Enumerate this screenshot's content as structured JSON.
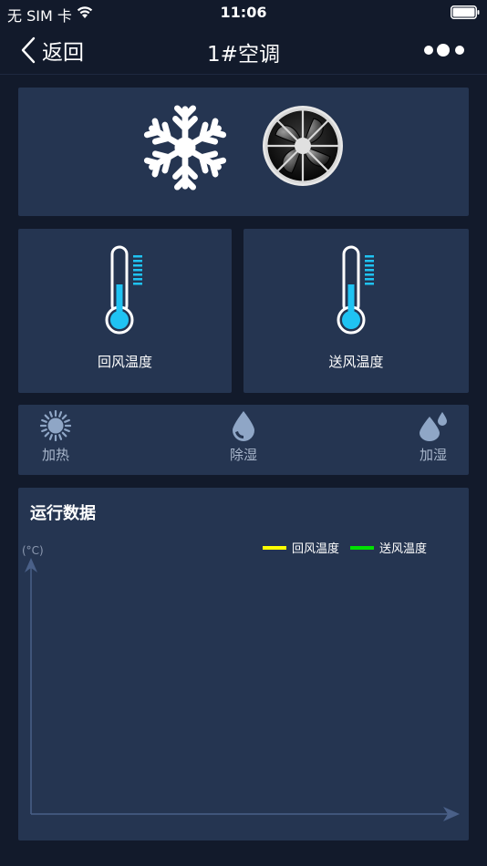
{
  "status_bar": {
    "carrier": "无 SIM 卡",
    "time": "11:06"
  },
  "nav": {
    "back_label": "返回",
    "title": "1#空调"
  },
  "mode_panel": {
    "icons": [
      "snowflake-icon",
      "fan-icon"
    ]
  },
  "temperatures": {
    "return_air_label": "回风温度",
    "supply_air_label": "送风温度",
    "thermometer_fill_color": "#1fc3f3"
  },
  "functions": [
    {
      "label": "加热",
      "icon": "sun-icon"
    },
    {
      "label": "除湿",
      "icon": "drop-icon"
    },
    {
      "label": "加湿",
      "icon": "drops-icon"
    }
  ],
  "run_data": {
    "title": "运行数据",
    "unit": "(°C)"
  },
  "chart_data": {
    "type": "line",
    "title": "运行数据",
    "ylabel": "(°C)",
    "series": [
      {
        "name": "回风温度",
        "color": "#ffff00",
        "values": []
      },
      {
        "name": "送风温度",
        "color": "#00e000",
        "values": []
      }
    ],
    "legend": "top-right",
    "grid": false
  },
  "colors": {
    "background": "#121a2b",
    "card": "#253551",
    "accent": "#1fc3f3"
  }
}
